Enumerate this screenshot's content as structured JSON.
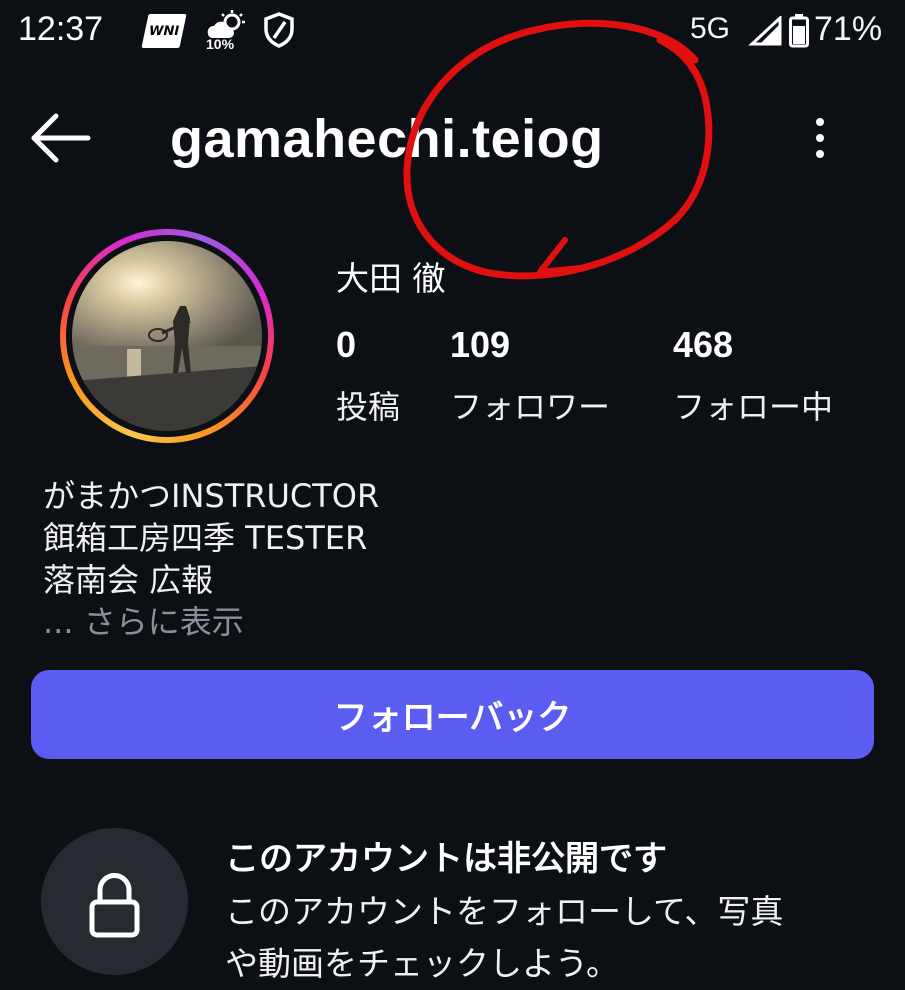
{
  "status_bar": {
    "time": "12:37",
    "app_icon": "WNI",
    "weather_pct": "10%",
    "network": "5G",
    "battery": "71%"
  },
  "header": {
    "username": "gamahechi.teiog",
    "back_icon": "arrow-left-icon",
    "menu_icon": "more-vertical-icon"
  },
  "profile": {
    "display_name": "大田 徹",
    "stats": [
      {
        "value": "0",
        "label": "投稿"
      },
      {
        "value": "109",
        "label": "フォロワー"
      },
      {
        "value": "468",
        "label": "フォロー中"
      }
    ],
    "bio_lines": [
      "がまかつINSTRUCTOR",
      "餌箱工房四季 TESTER",
      "落南会 広報"
    ],
    "bio_more": "... さらに表示"
  },
  "follow_button": "フォローバック",
  "private": {
    "title": "このアカウントは非公開です",
    "desc_lines": [
      "このアカウントをフォローして、写真",
      "や動画をチェックしよう。"
    ]
  },
  "colors": {
    "background": "#0c0f14",
    "button": "#5b5cf2",
    "annotation": "#e01010"
  }
}
